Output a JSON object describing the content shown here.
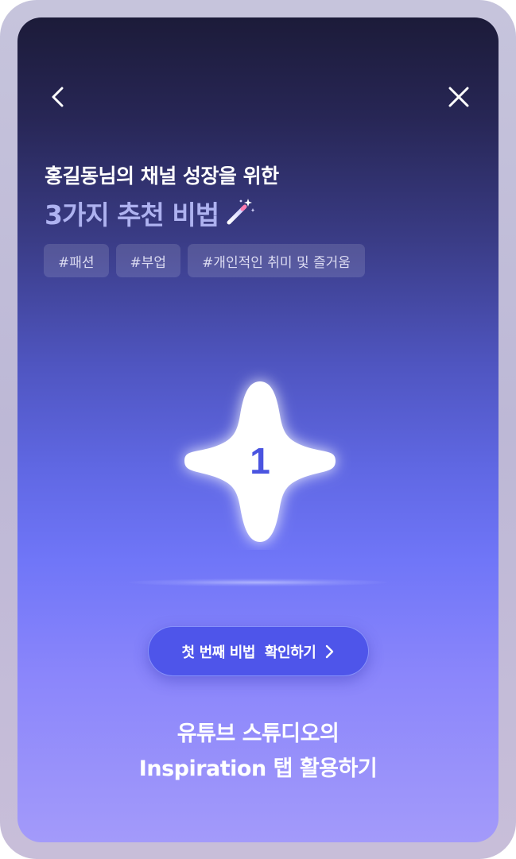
{
  "nav": {
    "back_icon": "chevron-left-icon",
    "close_icon": "close-icon"
  },
  "header": {
    "subtitle": "홍길동님의 채널 성장을 위한",
    "title": "3가지 추천 비법",
    "title_icon": "magic-wand-icon"
  },
  "tags": [
    {
      "label": "#패션"
    },
    {
      "label": "#부업"
    },
    {
      "label": "#개인적인 취미 및 즐거움"
    }
  ],
  "card": {
    "number": "1",
    "icon": "sparkle-star-icon"
  },
  "cta": {
    "label": "첫 번째 비법  확인하기",
    "icon": "chevron-right-icon"
  },
  "footer": {
    "line1": "유튜브 스튜디오의",
    "line2": "Inspiration 탭 활용하기"
  },
  "colors": {
    "accent": "#4e55ea",
    "title": "#aeb2f0",
    "number": "#4a54e0"
  }
}
